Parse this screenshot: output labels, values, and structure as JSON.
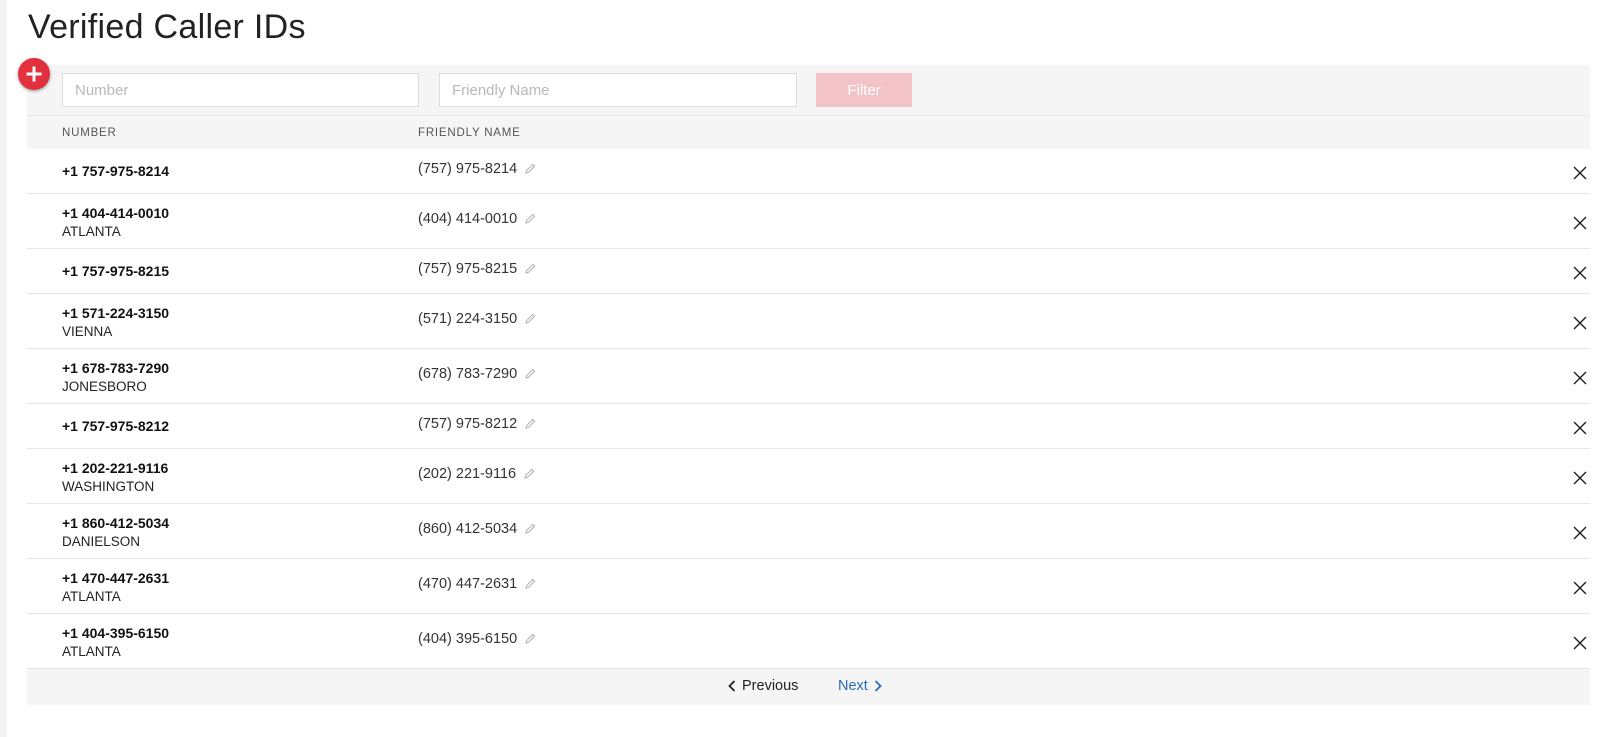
{
  "page": {
    "title": "Verified Caller IDs"
  },
  "filter": {
    "number_placeholder": "Number",
    "number_value": "",
    "friendly_placeholder": "Friendly Name",
    "friendly_value": "",
    "button_label": "Filter"
  },
  "table": {
    "headers": {
      "number": "NUMBER",
      "friendly": "FRIENDLY NAME"
    },
    "rows": [
      {
        "number": "+1 757-975-8214",
        "city": "",
        "friendly": "(757) 975-8214"
      },
      {
        "number": "+1 404-414-0010",
        "city": "ATLANTA",
        "friendly": "(404) 414-0010"
      },
      {
        "number": "+1 757-975-8215",
        "city": "",
        "friendly": "(757) 975-8215"
      },
      {
        "number": "+1 571-224-3150",
        "city": "VIENNA",
        "friendly": "(571) 224-3150"
      },
      {
        "number": "+1 678-783-7290",
        "city": "JONESBORO",
        "friendly": "(678) 783-7290"
      },
      {
        "number": "+1 757-975-8212",
        "city": "",
        "friendly": "(757) 975-8212"
      },
      {
        "number": "+1 202-221-9116",
        "city": "WASHINGTON",
        "friendly": "(202) 221-9116"
      },
      {
        "number": "+1 860-412-5034",
        "city": "DANIELSON",
        "friendly": "(860) 412-5034"
      },
      {
        "number": "+1 470-447-2631",
        "city": "ATLANTA",
        "friendly": "(470) 447-2631"
      },
      {
        "number": "+1 404-395-6150",
        "city": "ATLANTA",
        "friendly": "(404) 395-6150"
      }
    ]
  },
  "pager": {
    "previous_label": "Previous",
    "next_label": "Next"
  },
  "colors": {
    "accent": "#e2303f",
    "filter_button": "#f3c4c7",
    "link": "#2a6db5"
  },
  "icons": {
    "add": "plus-circle-icon",
    "edit": "pencil-icon",
    "delete": "close-icon",
    "prev": "chevron-left-icon",
    "next": "chevron-right-icon"
  }
}
